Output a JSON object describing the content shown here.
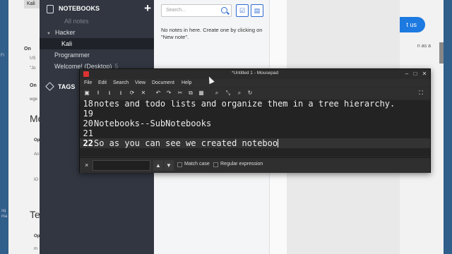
{
  "background_page": {
    "tab_label": "Kali",
    "left_fragments": [
      "On",
      "US",
      "\"Jo",
      "On",
      "wge",
      "Mo",
      "Op",
      "An",
      "iO",
      "Te",
      "Op",
      "m"
    ],
    "button_fragment": "t us",
    "right_fragment": "n as a"
  },
  "sidebar": {
    "header": "NOTEBOOKS",
    "add_label": "+",
    "items": [
      {
        "label": "All notes",
        "count": ""
      },
      {
        "label": "Hacker",
        "count": ""
      },
      {
        "label": "Kali",
        "count": ""
      },
      {
        "label": "Programmer",
        "count": ""
      },
      {
        "label": "Welcome! (Desktop)",
        "count": "5"
      }
    ],
    "tags_header": "TAGS",
    "left_edge_fragments": [
      "Fi",
      "sq",
      "ma"
    ]
  },
  "notelist": {
    "search_placeholder": "Search...",
    "empty_message": "No notes in here. Create one by clicking on \"New note\"."
  },
  "mousepad": {
    "title": "*Untitled 1 - Mousepad",
    "menu": [
      "File",
      "Edit",
      "Search",
      "View",
      "Document",
      "Help"
    ],
    "lines": [
      {
        "num": "18",
        "text": "notes and todo lists and organize them in a tree hierarchy."
      },
      {
        "num": "19",
        "text": ""
      },
      {
        "num": "20",
        "text": "Notebooks--SubNotebooks"
      },
      {
        "num": "21",
        "text": ""
      },
      {
        "num": "22",
        "text": "So as you can see we created noteboo"
      }
    ],
    "find_bar": {
      "close": "×",
      "match_case": "Match case",
      "regex": "Regular expression"
    }
  }
}
